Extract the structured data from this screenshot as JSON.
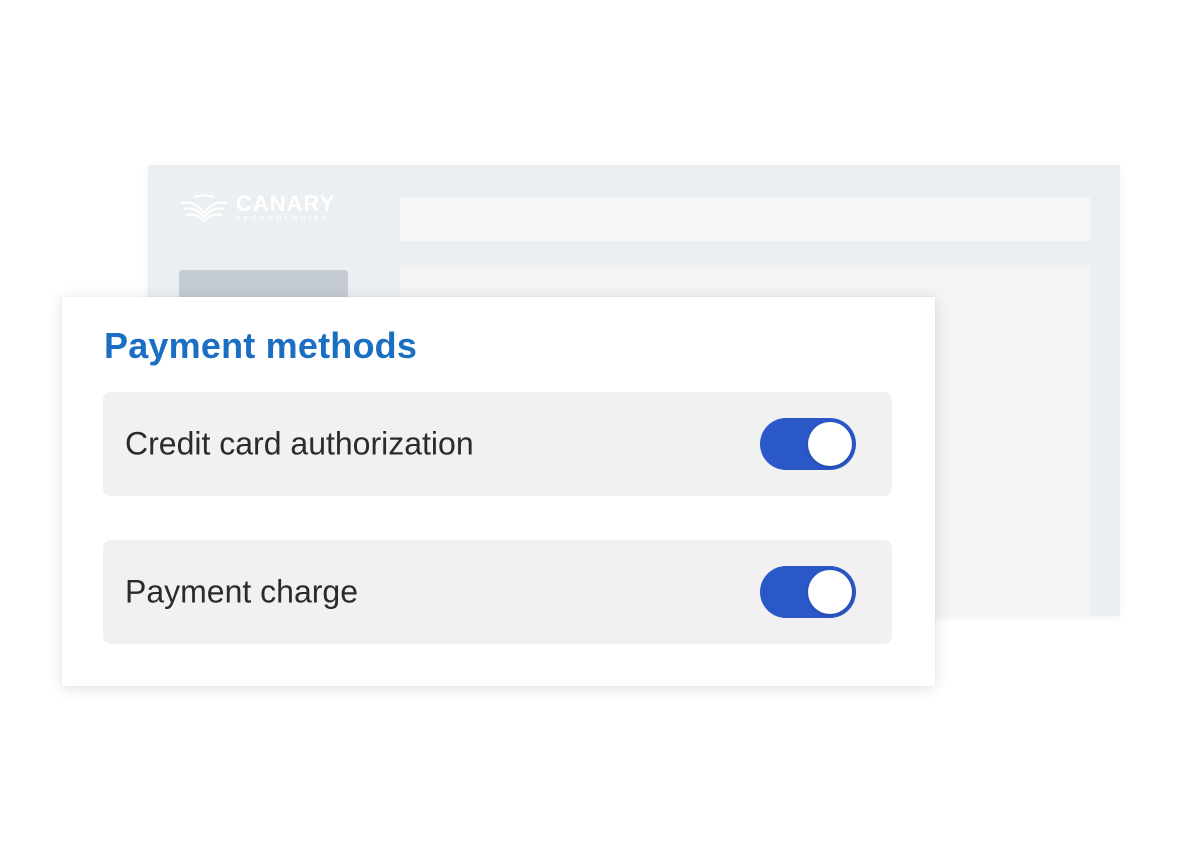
{
  "background_app": {
    "brand_name": "CANARY",
    "brand_subtitle": "TECHNOLOGIES"
  },
  "panel": {
    "title": "Payment methods",
    "title_color": "#1a6fc3",
    "settings": [
      {
        "label": "Credit card authorization",
        "enabled": true
      },
      {
        "label": "Payment charge",
        "enabled": true
      }
    ],
    "toggle_on_color": "#2b58c9"
  }
}
